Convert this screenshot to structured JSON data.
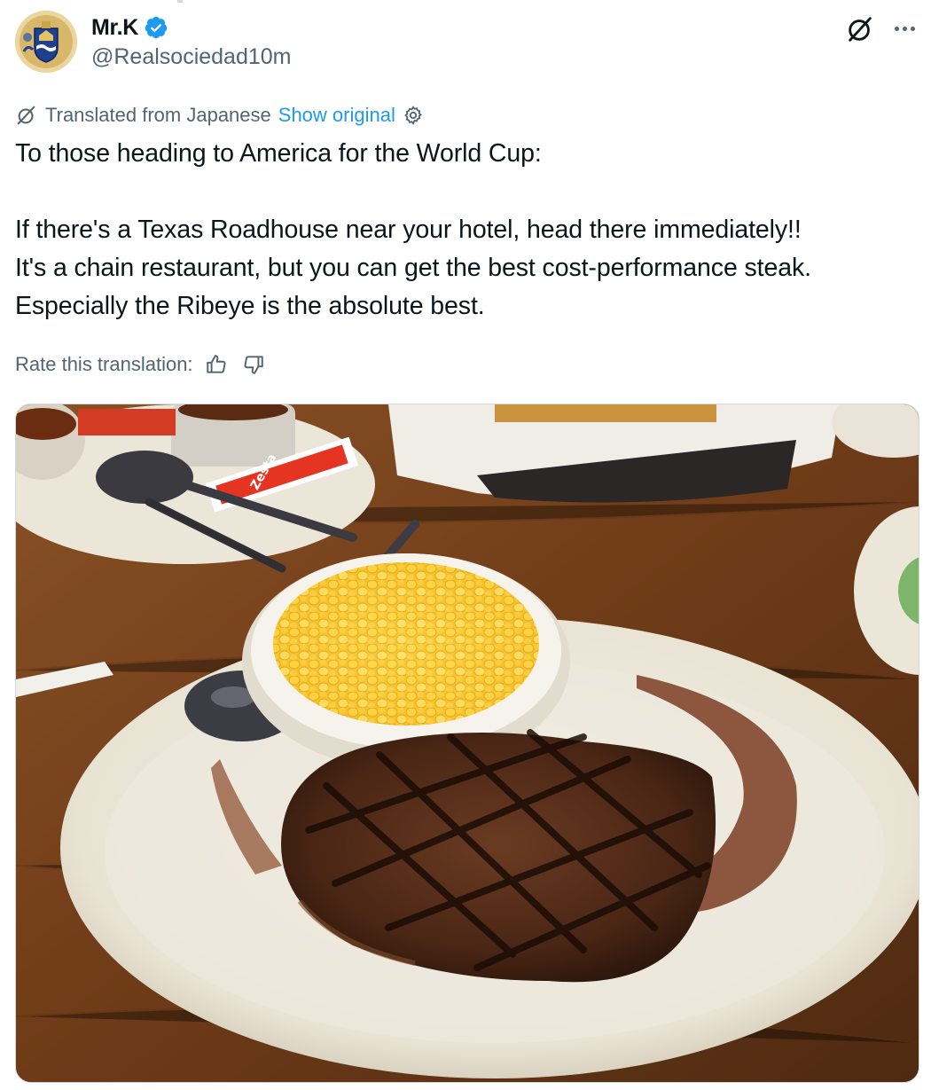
{
  "author": {
    "display_name": "Mr.K",
    "handle": "@Realsociedad10m",
    "verified": true
  },
  "translation": {
    "label": "Translated from Japanese",
    "show_original": "Show original"
  },
  "tweet": {
    "lines": [
      "To those heading to America for the World Cup:",
      "If there's a Texas Roadhouse near your hotel, head there immediately!!",
      "It's a chain restaurant, but you can get the best cost-performance steak.",
      "Especially the Ribeye is the absolute best."
    ]
  },
  "rate": {
    "label": "Rate this translation:"
  },
  "media": {
    "packet_text": "Zesta"
  },
  "colors": {
    "accent": "#1d9bf0",
    "secondary_text": "#536471",
    "text": "#0f1419"
  },
  "icons": [
    "grok-icon",
    "more-icon",
    "gear-icon",
    "thumbs-up-icon",
    "thumbs-down-icon",
    "verified-badge-icon"
  ]
}
